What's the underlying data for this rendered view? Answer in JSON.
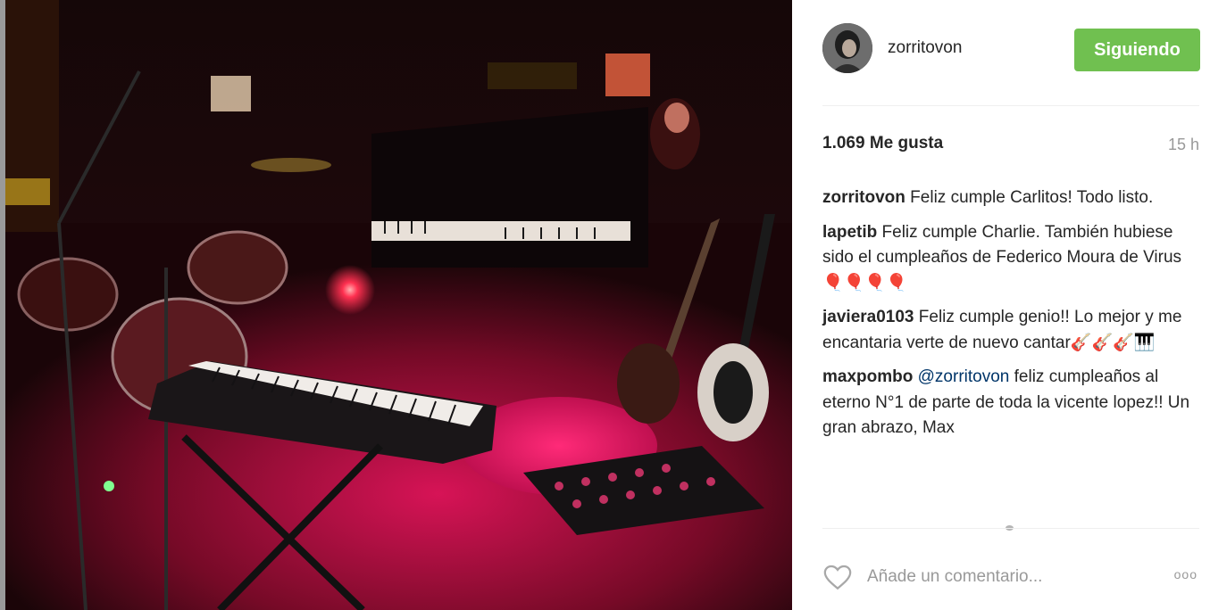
{
  "post": {
    "username": "zorritovon",
    "follow_label": "Siguiendo",
    "likes": "1.069 Me gusta",
    "time_ago": "15 h",
    "comments": [
      {
        "user": "zorritovon",
        "text": "Feliz cumple Carlitos! Todo listo."
      },
      {
        "user": "lapetib",
        "text": "Feliz cumple Charlie. También hubiese sido el cumpleaños de Federico Moura de Virus🎈🎈🎈🎈"
      },
      {
        "user": "javiera0103",
        "text": "Feliz cumple genio!! Lo mejor y me encantaria verte de nuevo cantar🎸🎸🎸🎹"
      },
      {
        "user": "maxpombo",
        "mention": "@zorritovon",
        "text": "feliz cumpleaños al eterno N°1 de parte de toda la vicente lopez!! Un gran abrazo, Max"
      }
    ],
    "comment_placeholder": "Añade un comentario...",
    "more_label": "ooo"
  },
  "icons": {
    "heart": "heart-icon",
    "more": "more-options-icon"
  },
  "colors": {
    "follow_button": "#70c050",
    "mention": "#003569",
    "photo_red": "#d0104a"
  }
}
